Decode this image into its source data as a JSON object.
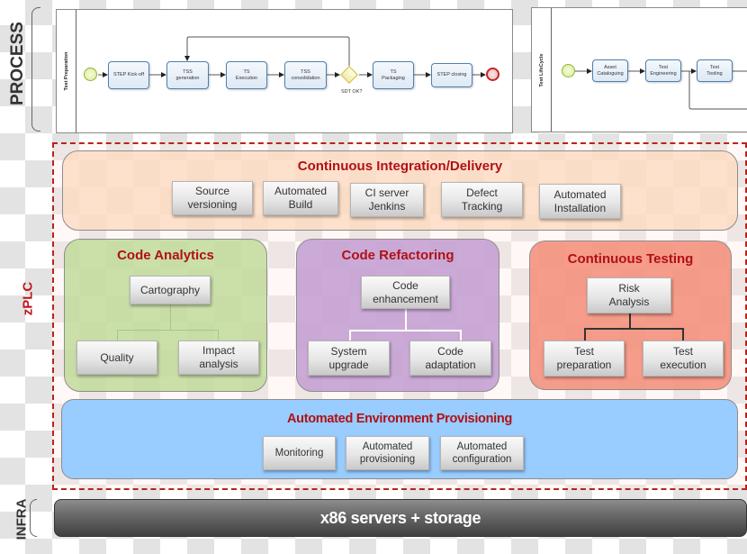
{
  "side_labels": {
    "process": "PROCESS",
    "zplc": "zPLC",
    "infra": "INFRA"
  },
  "colors": {
    "title_red": "#b01116",
    "dashed_frame": "#b8231f",
    "ci_panel": "#fde0c8",
    "analytics_panel": "#c9e0a6",
    "refactoring_panel": "#cba9d6",
    "testing_panel": "#f49c8c",
    "provisioning_panel": "#99ccff",
    "infra_bar": "#5a5a5a"
  },
  "process": {
    "test_preparation": {
      "lane_label": "Test Preparation",
      "tasks": [
        "STEP Kick-off",
        "TSS\ngeneration",
        "TS\nExecution",
        "TSS\nconsolidation",
        "TS\nPackaging",
        "STEP closing"
      ],
      "gateway_label": "SDT OK?"
    },
    "test_lifecycle": {
      "lane_label": "Test LifeCycle",
      "tasks": [
        "Asset\nCataloguing",
        "Test\nEngineering",
        "Test\nTooling"
      ]
    }
  },
  "ci_delivery": {
    "title": "Continuous Integration/Delivery",
    "items": [
      "Source\nversioning",
      "Automated\nBuild",
      "CI server\nJenkins",
      "Defect\nTracking",
      "Automated\nInstallation"
    ]
  },
  "code_analytics": {
    "title": "Code Analytics",
    "root": "Cartography",
    "children": [
      "Quality",
      "Impact\nanalysis"
    ]
  },
  "code_refactoring": {
    "title": "Code Refactoring",
    "root": "Code\nenhancement",
    "children": [
      "System\nupgrade",
      "Code\nadaptation"
    ]
  },
  "continuous_testing": {
    "title": "Continuous Testing",
    "root": "Risk\nAnalysis",
    "children": [
      "Test\npreparation",
      "Test\nexecution"
    ]
  },
  "provisioning": {
    "title": "Automated Environment Provisioning",
    "items": [
      "Monitoring",
      "Automated\nprovisioning",
      "Automated\nconfiguration"
    ]
  },
  "infra": {
    "label": "x86 servers + storage"
  }
}
